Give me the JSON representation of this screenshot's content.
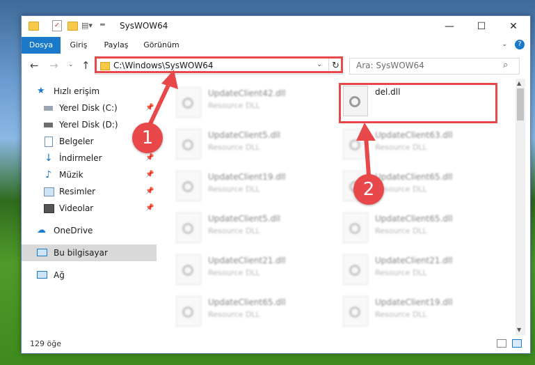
{
  "window": {
    "title": "SysWOW64"
  },
  "ribbon": {
    "tabs": [
      "Dosya",
      "Giriş",
      "Paylaş",
      "Görünüm"
    ],
    "help": "?"
  },
  "address": {
    "path": "C:\\Windows\\SysWOW64"
  },
  "search": {
    "placeholder": "Ara: SysWOW64"
  },
  "sidebar": {
    "items": [
      {
        "label": "Hızlı erişim",
        "icon": "star-icon"
      },
      {
        "label": "Yerel Disk (C:)",
        "icon": "drive-icon"
      },
      {
        "label": "Yerel Disk (D:)",
        "icon": "drive-icon"
      },
      {
        "label": "Belgeler",
        "icon": "documents-icon"
      },
      {
        "label": "İndirmeler",
        "icon": "download-icon"
      },
      {
        "label": "Müzik",
        "icon": "music-icon"
      },
      {
        "label": "Resimler",
        "icon": "pictures-icon"
      },
      {
        "label": "Videolar",
        "icon": "video-icon"
      },
      {
        "label": "OneDrive",
        "icon": "cloud-icon"
      },
      {
        "label": "Bu bilgisayar",
        "icon": "computer-icon"
      },
      {
        "label": "Ağ",
        "icon": "network-icon"
      }
    ]
  },
  "files": [
    {
      "name": "UpdateClient42.dll",
      "type": "Resource DLL"
    },
    {
      "name": "del.dll",
      "type": ""
    },
    {
      "name": "UpdateClient5.dll",
      "type": "Resource DLL"
    },
    {
      "name": "UpdateClient63.dll",
      "type": "Resource DLL"
    },
    {
      "name": "UpdateClient19.dll",
      "type": "Resource DLL"
    },
    {
      "name": "UpdateClient65.dll",
      "type": "Resource DLL"
    },
    {
      "name": "UpdateClient5.dll",
      "type": "Resource DLL"
    },
    {
      "name": "UpdateClient65.dll",
      "type": "Resource DLL"
    },
    {
      "name": "UpdateClient21.dll",
      "type": "Resource DLL"
    },
    {
      "name": "UpdateClient21.dll",
      "type": "Resource DLL"
    },
    {
      "name": "UpdateClient65.dll",
      "type": "Resource DLL"
    },
    {
      "name": "UpdateClient19.dll",
      "type": "Resource DLL"
    }
  ],
  "status": {
    "count": "129 öğe"
  },
  "annotations": {
    "badge1": "1",
    "badge2": "2",
    "color": "#e8484a"
  },
  "colors": {
    "accent": "#1979ca"
  }
}
